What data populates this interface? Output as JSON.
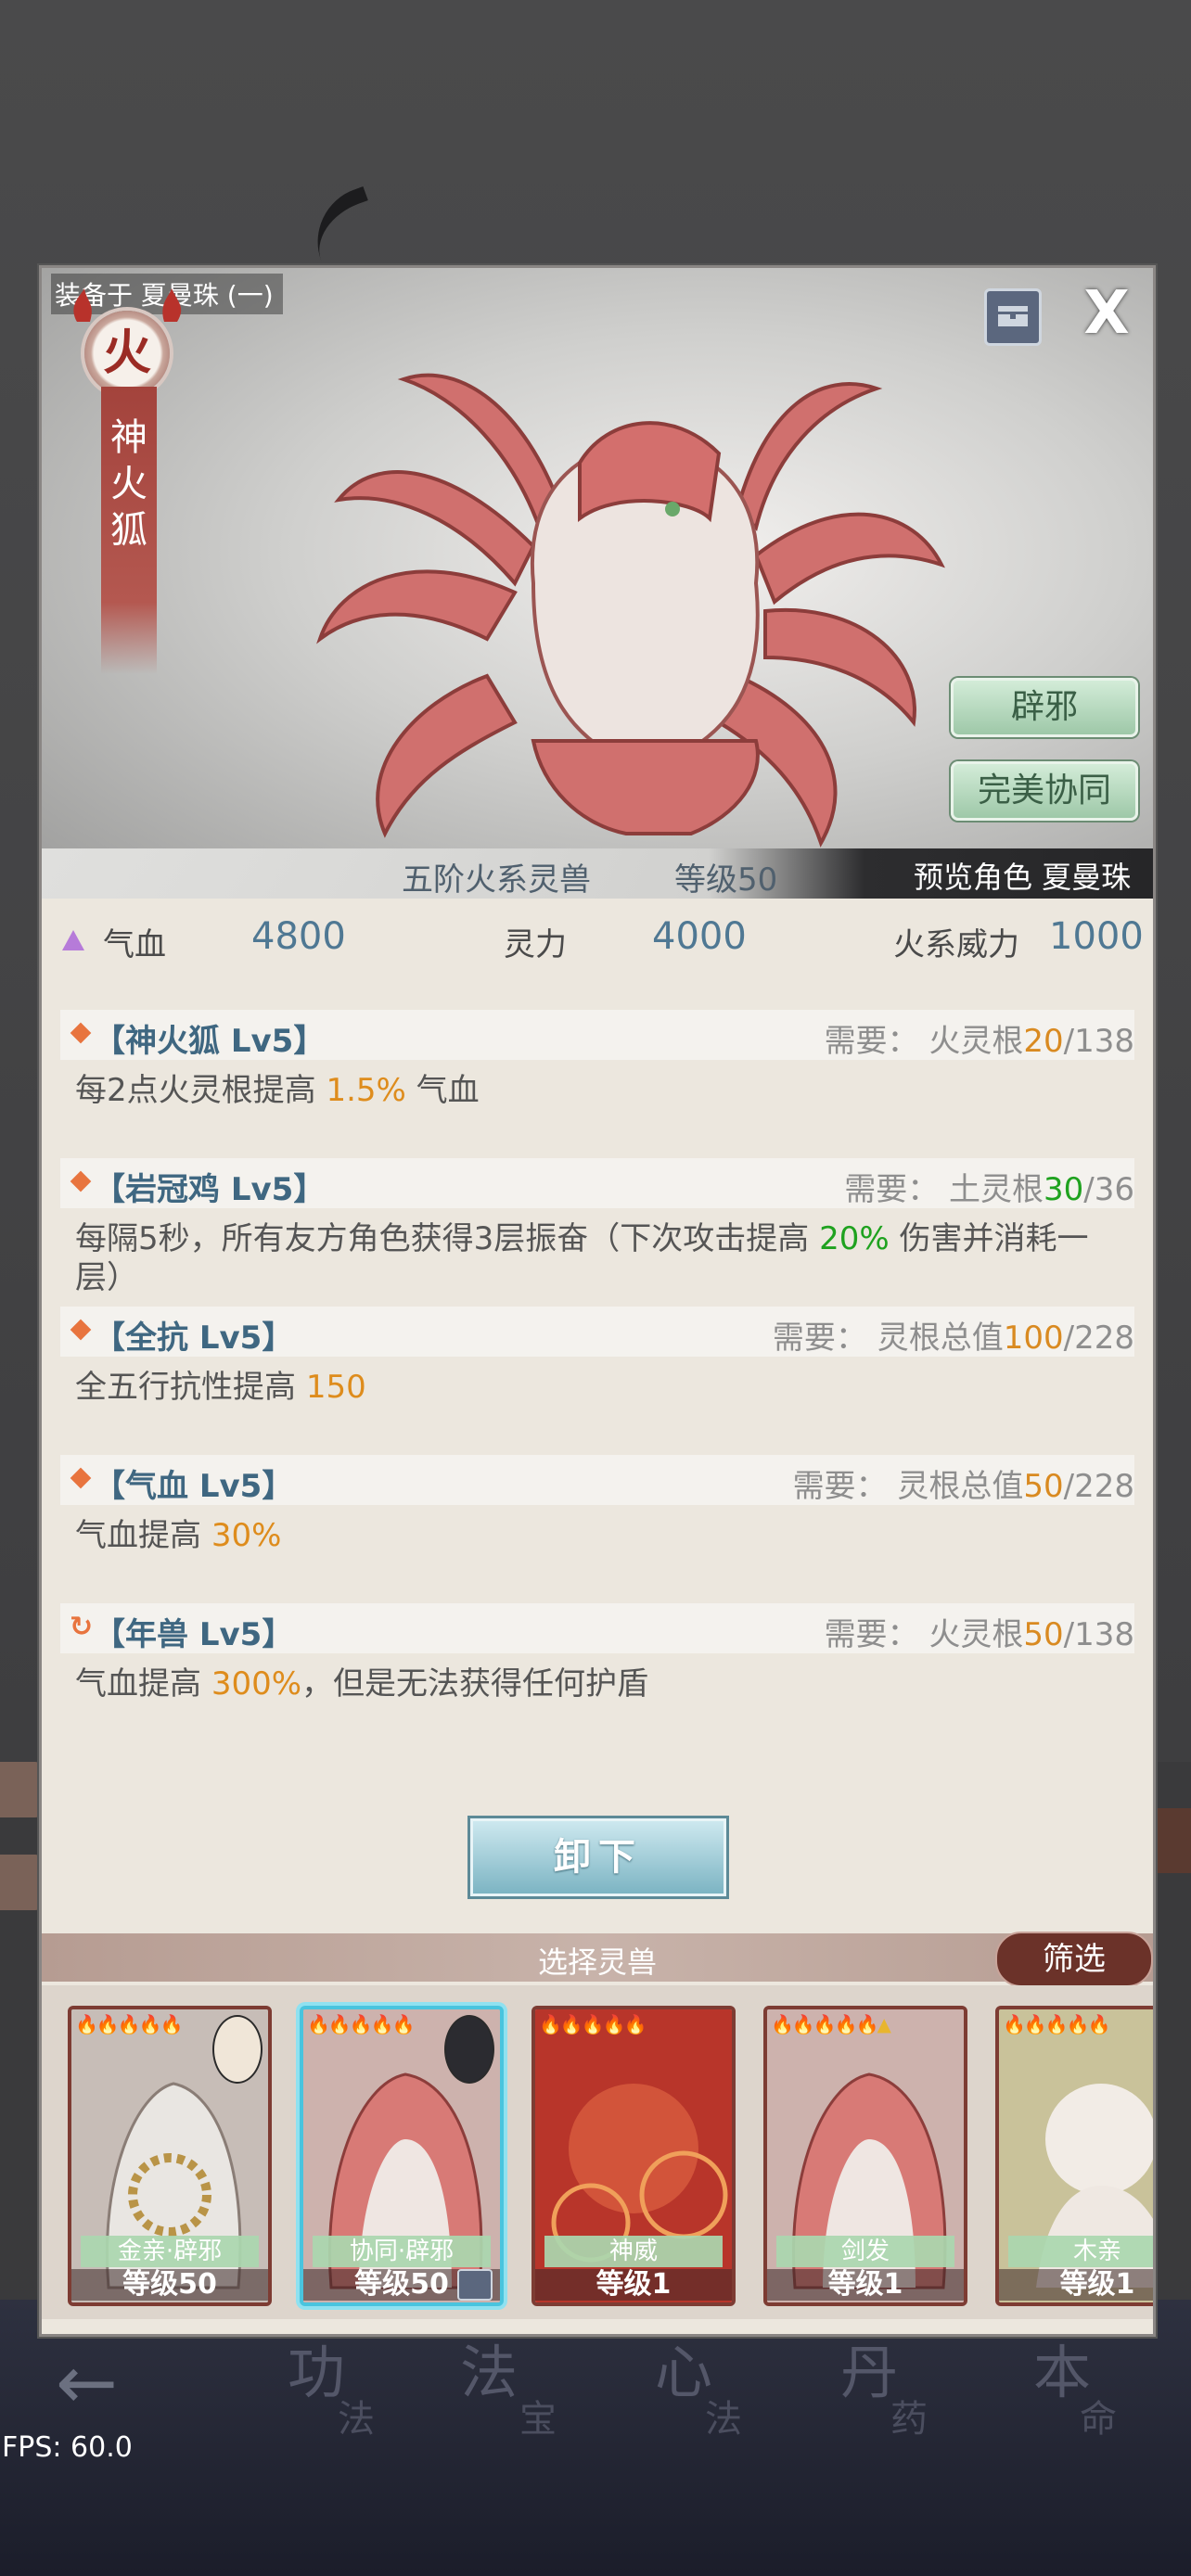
{
  "background": {
    "bottom_nav": [
      {
        "main": "功",
        "sub": "法"
      },
      {
        "main": "法",
        "sub": "宝"
      },
      {
        "main": "心",
        "sub": "法"
      },
      {
        "main": "丹",
        "sub": "药"
      },
      {
        "main": "本",
        "sub": "命"
      }
    ],
    "fps": "FPS: 60.0"
  },
  "modal": {
    "equipped_label": "装备于 夏曼珠 (一)",
    "element": "火",
    "beast_name_chars": [
      "神",
      "火",
      "狐"
    ],
    "close": "X",
    "tags": [
      "辟邪",
      "完美协同"
    ],
    "rank": "五阶火系灵兽",
    "level_label": "等级50",
    "preview": "预览角色 夏曼珠",
    "stats": [
      {
        "label": "气血",
        "value": "4800"
      },
      {
        "label": "灵力",
        "value": "4000"
      },
      {
        "label": "火系威力",
        "value": "1000"
      }
    ],
    "skills": [
      {
        "name": "【神火狐 Lv5】",
        "req_prefix": "需要：  火灵根",
        "req_cur": "20",
        "req_total": "/138",
        "desc_a": "每2点火灵根提高 ",
        "desc_hl": "1.5%",
        "desc_b": " 气血"
      },
      {
        "name": "【岩冠鸡 Lv5】",
        "req_prefix": "需要：  土灵根",
        "req_cur": "30",
        "req_total": "/36",
        "desc_a": "每隔5秒，所有友方角色获得3层振奋（下次攻击提高 ",
        "desc_hl": "20%",
        "desc_b": " 伤害并消耗一层）"
      },
      {
        "name": "【全抗 Lv5】",
        "req_prefix": "需要：  灵根总值",
        "req_cur": "100",
        "req_total": "/228",
        "desc_a": "全五行抗性提高 ",
        "desc_hl": "150",
        "desc_b": ""
      },
      {
        "name": "【气血 Lv5】",
        "req_prefix": "需要：  灵根总值",
        "req_cur": "50",
        "req_total": "/228",
        "desc_a": "气血提高 ",
        "desc_hl": "30%",
        "desc_b": ""
      },
      {
        "name": "【年兽 Lv5】",
        "req_prefix": "需要：  火灵根",
        "req_cur": "50",
        "req_total": "/138",
        "desc_a": "气血提高 ",
        "desc_hl": "300%",
        "desc_b": "，但是无法获得任何护盾"
      }
    ],
    "unequip": "卸下",
    "select_title": "选择灵兽",
    "filter": "筛选",
    "cards": [
      {
        "stars": "🔥🔥🔥🔥🔥",
        "tag": "金亲·辟邪",
        "level": "等级50"
      },
      {
        "stars": "🔥🔥🔥🔥🔥",
        "tag": "协同·辟邪",
        "level": "等级50"
      },
      {
        "stars": "🔥🔥🔥🔥🔥",
        "tag": "神威",
        "level": "等级1"
      },
      {
        "stars": "🔥🔥🔥🔥🔥▲",
        "tag": "剑发",
        "level": "等级1"
      },
      {
        "stars": "🔥🔥🔥🔥🔥",
        "tag": "木亲",
        "level": "等级1"
      }
    ]
  },
  "colors": {
    "accent_orange": "#de8c1c",
    "accent_green": "#1fa21f",
    "stat_blue": "#4f7893",
    "brand_red": "#9b2b24"
  }
}
